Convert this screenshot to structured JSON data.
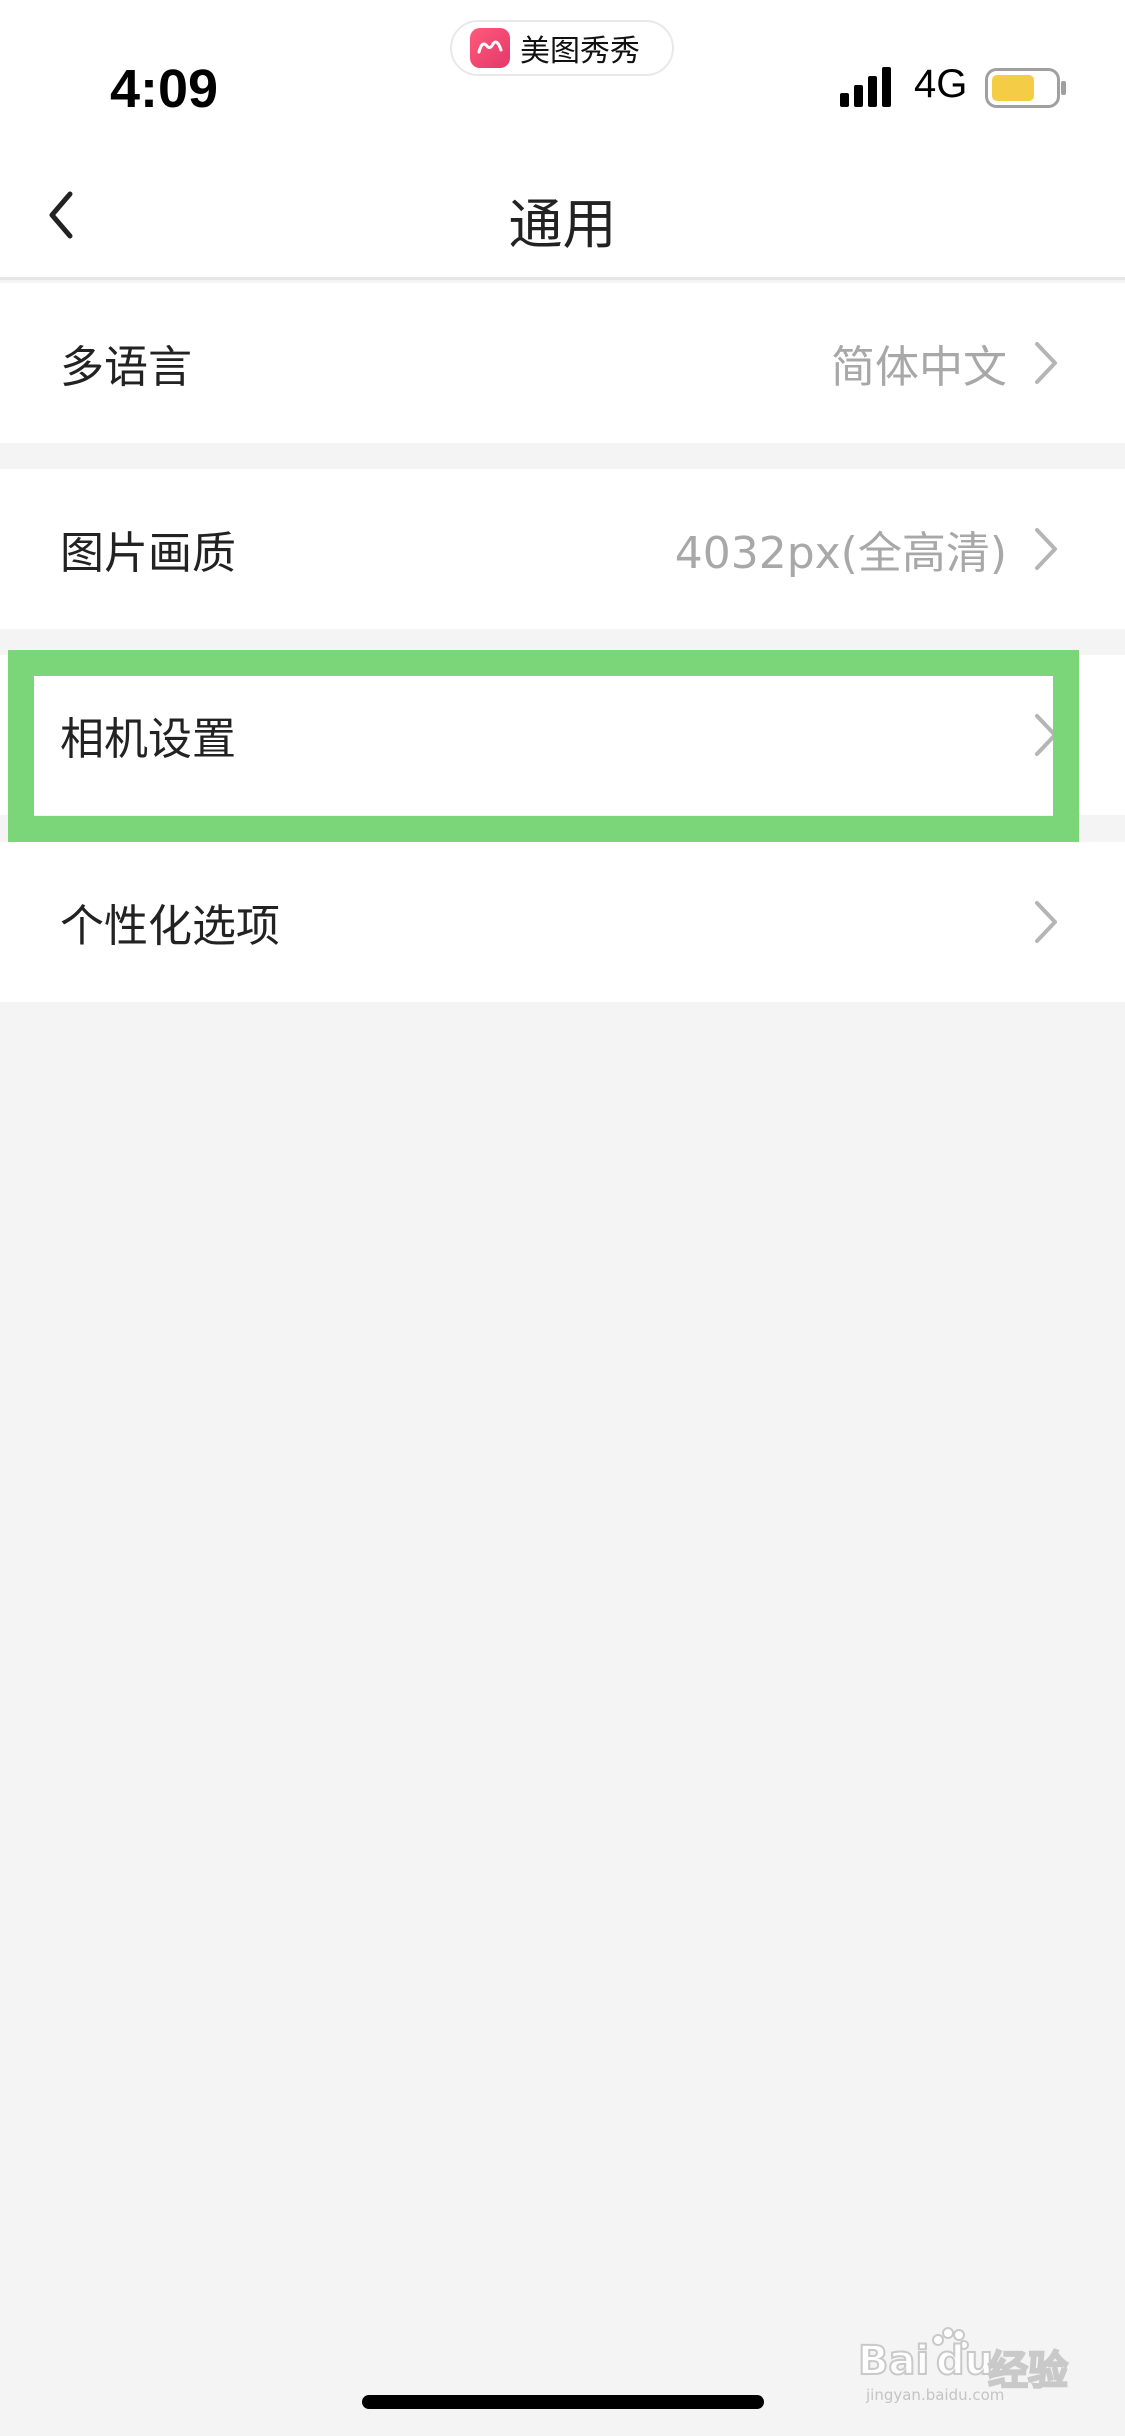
{
  "status_bar": {
    "time": "4:09",
    "app_name": "美图秀秀",
    "network": "4G",
    "battery_color": "#f5cc45"
  },
  "nav": {
    "title": "通用",
    "back_icon": "chevron-left-icon"
  },
  "settings": [
    {
      "label": "多语言",
      "value": "简体中文"
    },
    {
      "label": "图片画质",
      "value": "4032px(全高清)"
    },
    {
      "label": "相机设置",
      "value": ""
    },
    {
      "label": "个性化选项",
      "value": ""
    }
  ],
  "colors": {
    "highlight": "#7bd67a",
    "background": "#f4f4f4",
    "row_background": "#ffffff",
    "secondary_text": "#a8a8a8"
  },
  "watermark": {
    "brand": "Bai",
    "mid": "du",
    "suffix": "经验",
    "url": "jingyan.baidu.com"
  }
}
